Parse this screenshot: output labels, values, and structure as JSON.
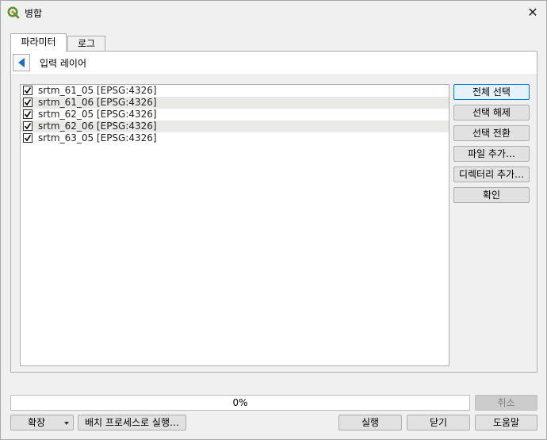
{
  "window": {
    "title": "병합",
    "close_glyph": "✕",
    "icon": "qgis-logo-icon"
  },
  "tabs": [
    {
      "label": "파라미터",
      "active": true
    },
    {
      "label": "로그",
      "active": false
    }
  ],
  "header": {
    "back_icon": "back-arrow-icon",
    "title": "입력 레이어"
  },
  "layers": [
    {
      "label": "srtm_61_05 [EPSG:4326]",
      "checked": true
    },
    {
      "label": "srtm_61_06 [EPSG:4326]",
      "checked": true
    },
    {
      "label": "srtm_62_05 [EPSG:4326]",
      "checked": true
    },
    {
      "label": "srtm_62_06 [EPSG:4326]",
      "checked": true
    },
    {
      "label": "srtm_63_05 [EPSG:4326]",
      "checked": true
    }
  ],
  "side_buttons": {
    "select_all": "전체 선택",
    "deselect": "선택 해제",
    "toggle": "선택 전환",
    "add_file": "파일 추가…",
    "add_directory": "디렉터리 추가…",
    "ok": "확인"
  },
  "progress": {
    "value": 0,
    "text": "0%"
  },
  "footer": {
    "cancel": "취소",
    "advanced": "확장",
    "batch": "배치 프로세스로 실행…",
    "run": "실행",
    "close": "닫기",
    "help": "도움말"
  },
  "colors": {
    "accent": "#0078d7",
    "qgis_green": "#589632",
    "qgis_yellow": "#ee7913"
  }
}
